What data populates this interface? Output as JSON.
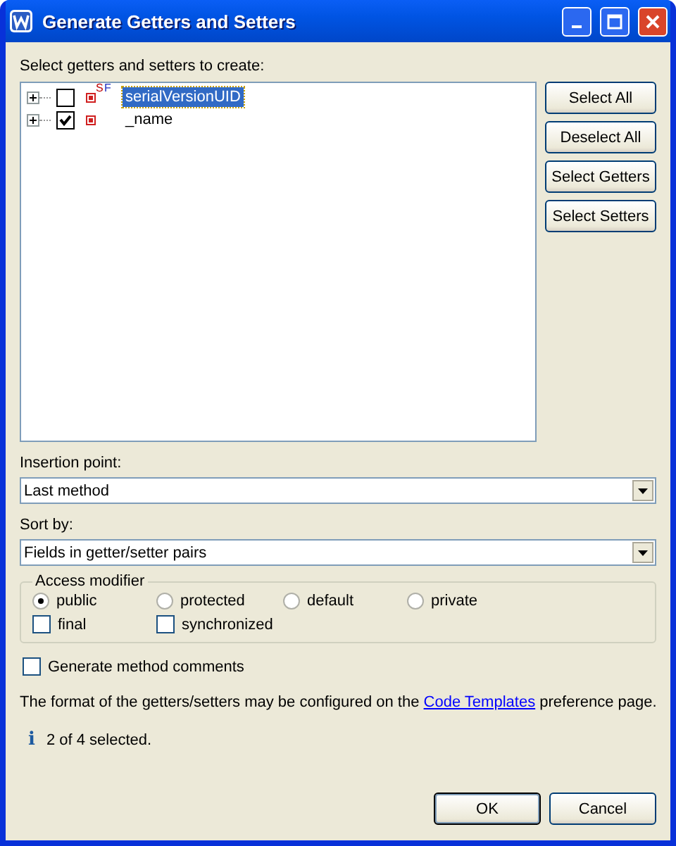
{
  "window": {
    "title": "Generate Getters and Setters"
  },
  "tree": {
    "label": "Select getters and setters to create:",
    "items": [
      {
        "name": "serialVersionUID",
        "checked": false,
        "selected": true,
        "overlays": [
          {
            "text": "S",
            "kind": "static"
          },
          {
            "text": "F",
            "kind": "final"
          }
        ]
      },
      {
        "name": "_name",
        "checked": true,
        "selected": false
      }
    ]
  },
  "side_buttons": [
    "Select All",
    "Deselect All",
    "Select Getters",
    "Select Setters"
  ],
  "insertion_point": {
    "label": "Insertion point:",
    "value": "Last method"
  },
  "sort_by": {
    "label": "Sort by:",
    "value": "Fields in getter/setter pairs"
  },
  "access_modifier": {
    "title": "Access modifier",
    "options": [
      {
        "label": "public",
        "selected": true
      },
      {
        "label": "protected",
        "selected": false
      },
      {
        "label": "default",
        "selected": false
      },
      {
        "label": "private",
        "selected": false
      }
    ],
    "flags": [
      {
        "label": "final",
        "checked": false
      },
      {
        "label": "synchronized",
        "checked": false
      }
    ]
  },
  "generate_comments": {
    "label": "Generate method comments",
    "checked": false
  },
  "note": {
    "before": "The format of the getters/setters may be configured on the",
    "link": "Code Templates",
    "after": "preference page."
  },
  "status": {
    "icon": "i",
    "text": "2 of 4 selected."
  },
  "buttons": [
    {
      "label": "OK",
      "default": true
    },
    {
      "label": "Cancel",
      "default": false
    }
  ]
}
